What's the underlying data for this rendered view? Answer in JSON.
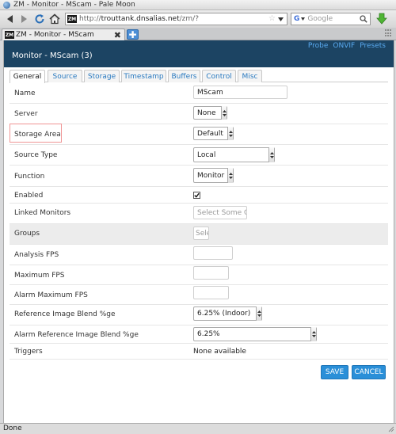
{
  "window": {
    "title": "ZM - Monitor - MScam - Pale Moon"
  },
  "browser": {
    "url_prefix": "http://",
    "url_host": "trouttank.dnsalias.net",
    "url_path": "/zm/?",
    "site_icon_text": "ZM",
    "search_engine": "G",
    "search_placeholder": "Google",
    "tab_title": "ZM - Monitor - MScam",
    "status_text": "Done"
  },
  "header": {
    "title": "Monitor - MScam (3)",
    "links": [
      "Probe",
      "ONVIF",
      "Presets"
    ]
  },
  "tabs": [
    "General",
    "Source",
    "Storage",
    "Timestamp",
    "Buffers",
    "Control",
    "Misc"
  ],
  "active_tab": "General",
  "form": {
    "name": {
      "label": "Name",
      "value": "MScam"
    },
    "server": {
      "label": "Server",
      "value": "None"
    },
    "storage_area": {
      "label": "Storage Area",
      "value": "Default"
    },
    "source_type": {
      "label": "Source Type",
      "value": "Local"
    },
    "function": {
      "label": "Function",
      "value": "Monitor"
    },
    "enabled": {
      "label": "Enabled",
      "checked": true
    },
    "linked_monitors": {
      "label": "Linked Monitors",
      "placeholder": "Select Some Op"
    },
    "groups": {
      "label": "Groups",
      "placeholder": "Sele"
    },
    "analysis_fps": {
      "label": "Analysis FPS",
      "value": ""
    },
    "maximum_fps": {
      "label": "Maximum FPS",
      "value": ""
    },
    "alarm_maximum_fps": {
      "label": "Alarm Maximum FPS",
      "value": ""
    },
    "reference_blend": {
      "label": "Reference Image Blend %ge",
      "value": "6.25% (Indoor)"
    },
    "alarm_reference_blend": {
      "label": "Alarm Reference Image Blend %ge",
      "value": "6.25%"
    },
    "triggers": {
      "label": "Triggers",
      "value": "None available"
    }
  },
  "buttons": {
    "save": "SAVE",
    "cancel": "CANCEL"
  },
  "colors": {
    "header_bg": "#1c4463",
    "link": "#5aaaf0",
    "button": "#2a8fd8",
    "highlight_border": "#f09595"
  }
}
